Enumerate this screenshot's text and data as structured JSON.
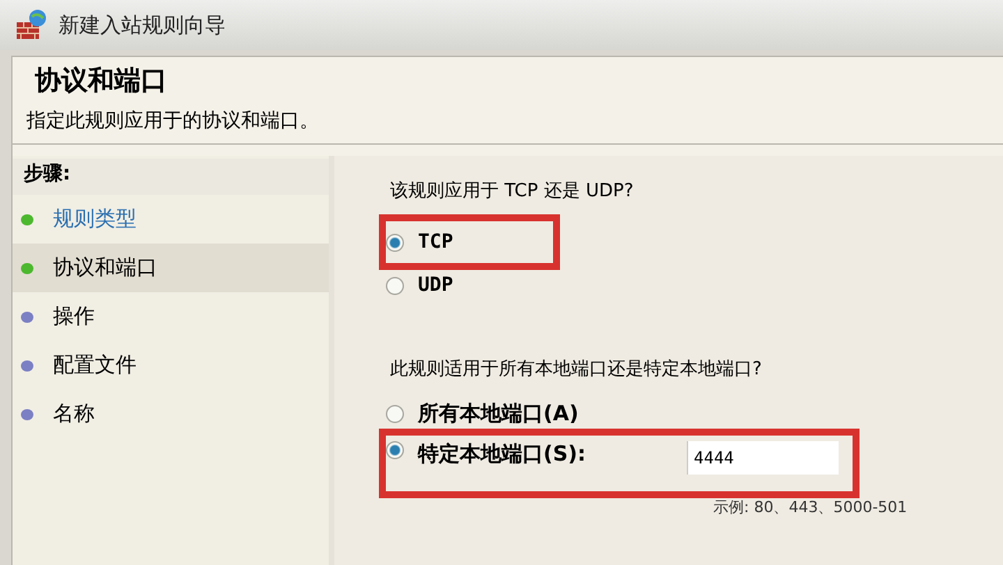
{
  "window": {
    "title": "新建入站规则向导"
  },
  "header": {
    "title": "协议和端口",
    "description": "指定此规则应用于的协议和端口。"
  },
  "steps": {
    "heading": "步骤:",
    "items": [
      {
        "label": "规则类型",
        "color": "#4cb82e",
        "kind": "link",
        "selected": false
      },
      {
        "label": "协议和端口",
        "color": "#4cb82e",
        "kind": "text",
        "selected": true
      },
      {
        "label": "操作",
        "color": "#7b7fc4",
        "kind": "text",
        "selected": false
      },
      {
        "label": "配置文件",
        "color": "#7b7fc4",
        "kind": "text",
        "selected": false
      },
      {
        "label": "名称",
        "color": "#7b7fc4",
        "kind": "text",
        "selected": false
      }
    ]
  },
  "protocol": {
    "question": "该规则应用于 TCP 还是 UDP?",
    "options": [
      {
        "label": "TCP",
        "selected": true,
        "highlighted": true
      },
      {
        "label": "UDP",
        "selected": false,
        "highlighted": false
      }
    ]
  },
  "ports": {
    "question": "此规则适用于所有本地端口还是特定本地端口?",
    "options": [
      {
        "label": "所有本地端口(A)",
        "selected": false,
        "highlighted": false
      },
      {
        "label": "特定本地端口(S):",
        "selected": true,
        "highlighted": true,
        "value": "4444"
      }
    ],
    "example": "示例: 80、443、5000-501"
  }
}
